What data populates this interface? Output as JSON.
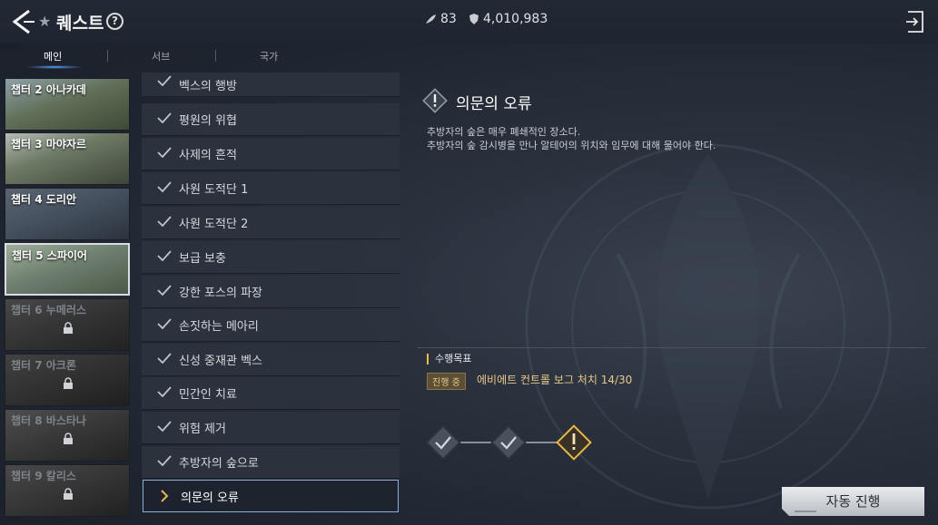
{
  "header": {
    "title": "퀘스트",
    "resource_a": "83",
    "resource_b": "4,010,983"
  },
  "tabs": [
    {
      "label": "메인",
      "active": true
    },
    {
      "label": "서브",
      "active": false
    },
    {
      "label": "국가",
      "active": false
    }
  ],
  "chapters": [
    {
      "label": "챕터 2 아나카데",
      "locked": false,
      "selected": false
    },
    {
      "label": "챕터 3 마야자르",
      "locked": false,
      "selected": false
    },
    {
      "label": "챕터 4 도리안",
      "locked": false,
      "selected": false
    },
    {
      "label": "챕터 5 스파이어",
      "locked": false,
      "selected": true
    },
    {
      "label": "챕터 6 누메러스",
      "locked": true,
      "selected": false
    },
    {
      "label": "챕터 7 아크론",
      "locked": true,
      "selected": false
    },
    {
      "label": "챕터 8 바스타나",
      "locked": true,
      "selected": false
    },
    {
      "label": "챕터 9 칼리스",
      "locked": true,
      "selected": false
    }
  ],
  "quests": [
    {
      "label": "벡스의 행방",
      "done": true
    },
    {
      "label": "평원의 위협",
      "done": true
    },
    {
      "label": "사제의 흔적",
      "done": true
    },
    {
      "label": "사원 도적단 1",
      "done": true
    },
    {
      "label": "사원 도적단 2",
      "done": true
    },
    {
      "label": "보급 보충",
      "done": true
    },
    {
      "label": "강한 포스의 파장",
      "done": true
    },
    {
      "label": "손짓하는 메아리",
      "done": true
    },
    {
      "label": "신성 중재관 벡스",
      "done": true
    },
    {
      "label": "민간인 치료",
      "done": true
    },
    {
      "label": "위험 제거",
      "done": true
    },
    {
      "label": "추방자의 숲으로",
      "done": true
    },
    {
      "label": "의문의 오류",
      "done": false,
      "current": true
    }
  ],
  "detail": {
    "title": "의문의 오류",
    "desc_line1": "추방자의 숲은 매우 폐쇄적인 장소다.",
    "desc_line2": "추방자의 숲 감시병을 만나 알테어의 위치와 임무에 대해 물어야 한다.",
    "objective_header": "수행목표",
    "objective_status": "진행 중",
    "objective_text": "에비에트 컨트롤 보그 처치 14/30"
  },
  "auto_button": "자동 진행",
  "colors": {
    "accent_gold": "#e7b84a",
    "objective_text": "#e7c88a",
    "tab_glow": "#5aa0ff"
  }
}
